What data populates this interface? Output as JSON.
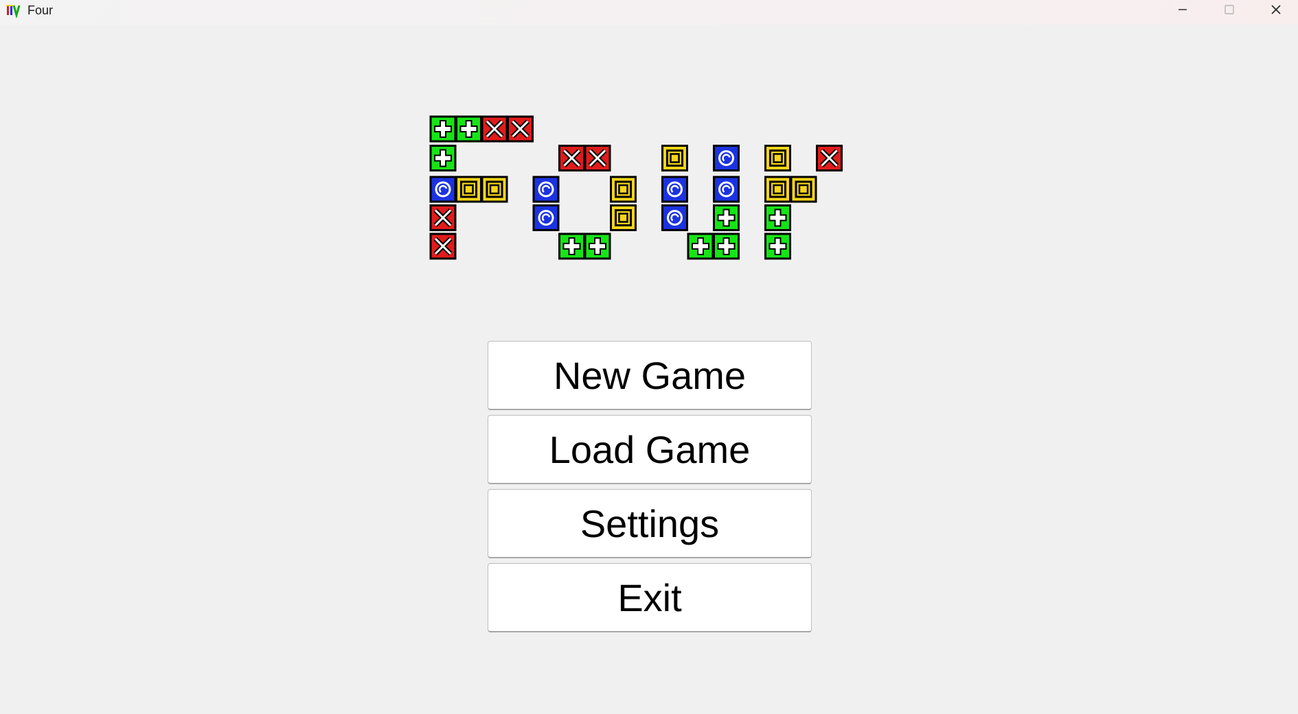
{
  "window": {
    "title": "Four",
    "icon": "app-icon",
    "controls": [
      "minimize-icon",
      "maximize-icon",
      "close-icon"
    ]
  },
  "logo": {
    "text": "Four",
    "tile_types": {
      "G": {
        "color": "#16e416",
        "symbol": "plus"
      },
      "R": {
        "color": "#e11b1b",
        "symbol": "x"
      },
      "B": {
        "color": "#1b33e0",
        "symbol": "spiral"
      },
      "Y": {
        "color": "#f5d51a",
        "symbol": "square"
      }
    },
    "letters": [
      {
        "letter": "F",
        "tiles": [
          {
            "col": 0,
            "row": 0,
            "t": "G"
          },
          {
            "col": 1,
            "row": 0,
            "t": "G"
          },
          {
            "col": 2,
            "row": 0,
            "t": "R"
          },
          {
            "col": 3,
            "row": 0,
            "t": "R"
          },
          {
            "col": 0,
            "row": 1,
            "t": "G"
          },
          {
            "col": 0,
            "row": 2,
            "t": "B"
          },
          {
            "col": 1,
            "row": 2,
            "t": "Y"
          },
          {
            "col": 2,
            "row": 2,
            "t": "Y"
          },
          {
            "col": 0,
            "row": 3,
            "t": "R"
          },
          {
            "col": 0,
            "row": 4,
            "t": "R"
          }
        ]
      },
      {
        "letter": "o",
        "tiles": [
          {
            "col": 5,
            "row": 1,
            "t": "R"
          },
          {
            "col": 6,
            "row": 1,
            "t": "R"
          },
          {
            "col": 4,
            "row": 2,
            "t": "B"
          },
          {
            "col": 7,
            "row": 2,
            "t": "Y"
          },
          {
            "col": 4,
            "row": 3,
            "t": "B"
          },
          {
            "col": 7,
            "row": 3,
            "t": "Y"
          },
          {
            "col": 5,
            "row": 4,
            "t": "G"
          },
          {
            "col": 6,
            "row": 4,
            "t": "G"
          }
        ]
      },
      {
        "letter": "u",
        "tiles": [
          {
            "col": 9,
            "row": 1,
            "t": "Y"
          },
          {
            "col": 11,
            "row": 1,
            "t": "B"
          },
          {
            "col": 9,
            "row": 2,
            "t": "B"
          },
          {
            "col": 11,
            "row": 2,
            "t": "B"
          },
          {
            "col": 9,
            "row": 3,
            "t": "B"
          },
          {
            "col": 11,
            "row": 3,
            "t": "G"
          },
          {
            "col": 10,
            "row": 4,
            "t": "G"
          },
          {
            "col": 11,
            "row": 4,
            "t": "G"
          }
        ]
      },
      {
        "letter": "r",
        "tiles": [
          {
            "col": 13,
            "row": 1,
            "t": "Y"
          },
          {
            "col": 15,
            "row": 1,
            "t": "R"
          },
          {
            "col": 13,
            "row": 2,
            "t": "Y"
          },
          {
            "col": 14,
            "row": 2,
            "t": "Y"
          },
          {
            "col": 13,
            "row": 3,
            "t": "G"
          },
          {
            "col": 13,
            "row": 4,
            "t": "G"
          }
        ]
      }
    ]
  },
  "menu": {
    "new_game": "New Game",
    "load_game": "Load Game",
    "settings": "Settings",
    "exit": "Exit"
  }
}
